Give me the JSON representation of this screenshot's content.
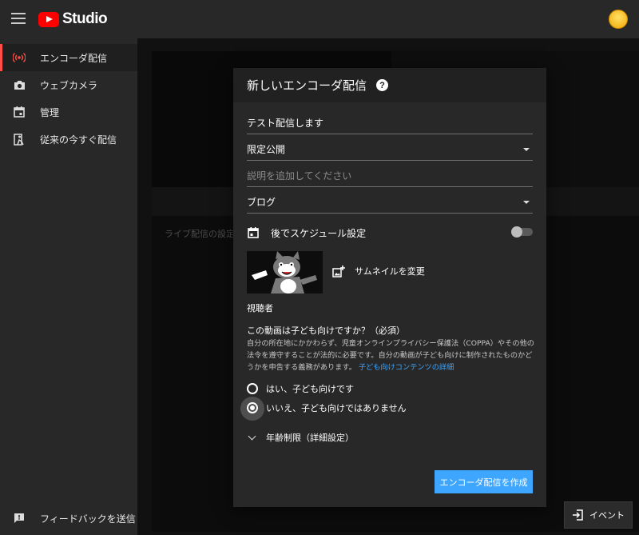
{
  "header": {
    "logo_text": "Studio"
  },
  "sidebar": {
    "items": [
      {
        "label": "エンコーダ配信",
        "icon": "broadcast-icon"
      },
      {
        "label": "ウェブカメラ",
        "icon": "camera-icon"
      },
      {
        "label": "管理",
        "icon": "calendar-icon"
      },
      {
        "label": "従来の今すぐ配信",
        "icon": "live-legacy-icon"
      }
    ],
    "footer_label": "フィードバックを送信"
  },
  "background": {
    "settings_label": "ライブ配信の設定"
  },
  "dialog": {
    "title": "新しいエンコーダ配信",
    "stream_title": "テスト配信します",
    "visibility": "限定公開",
    "description_placeholder": "説明を追加してください",
    "category": "ブログ",
    "schedule_label": "後でスケジュール設定",
    "thumbnail_change": "サムネイルを変更",
    "audience_title": "視聴者",
    "kids_question": "この動画は子ども向けですか？（必須）",
    "kids_description": "自分の所在地にかかわらず、児童オンラインプライバシー保護法（COPPA）やその他の法令を遵守することが法的に必要です。自分の動画が子ども向けに制作されたものかどうかを申告する義務があります。",
    "kids_link": "子ども向けコンテンツの詳細",
    "options": [
      "はい、子ども向けです",
      "いいえ、子ども向けではありません"
    ],
    "selected_option": 1,
    "age_restriction": "年齢制限（詳細設定）",
    "create_button": "エンコーダ配信を作成"
  },
  "event_button": "イベント",
  "colors": {
    "accent_blue": "#3ea6ff",
    "brand_red": "#ff0000",
    "active_indicator": "#ff4e45"
  }
}
